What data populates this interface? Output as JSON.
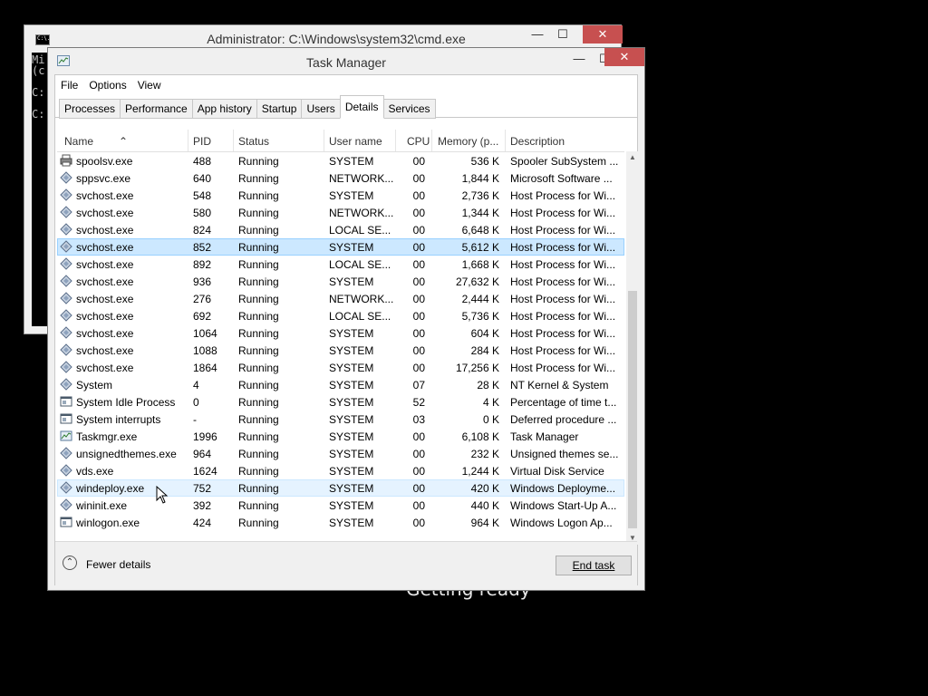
{
  "cmd_window": {
    "title": "Administrator: C:\\Windows\\system32\\cmd.exe",
    "icon_text": "C:\\.",
    "console_lines": [
      "Mi",
      "(c",
      "",
      "C:",
      "",
      "C:"
    ]
  },
  "background_text": "Getting ready",
  "task_manager": {
    "title": "Task Manager",
    "menu": [
      "File",
      "Options",
      "View"
    ],
    "tabs": [
      "Processes",
      "Performance",
      "App history",
      "Startup",
      "Users",
      "Details",
      "Services"
    ],
    "active_tab": "Details",
    "columns": [
      "Name",
      "PID",
      "Status",
      "User name",
      "CPU",
      "Memory (p...",
      "Description"
    ],
    "rows": [
      {
        "name": "spoolsv.exe",
        "pid": "488",
        "status": "Running",
        "user": "SYSTEM",
        "cpu": "00",
        "mem": "536 K",
        "desc": "Spooler SubSystem ...",
        "icon": "printer-icon"
      },
      {
        "name": "sppsvc.exe",
        "pid": "640",
        "status": "Running",
        "user": "NETWORK...",
        "cpu": "00",
        "mem": "1,844 K",
        "desc": "Microsoft Software ...",
        "icon": "process-icon"
      },
      {
        "name": "svchost.exe",
        "pid": "548",
        "status": "Running",
        "user": "SYSTEM",
        "cpu": "00",
        "mem": "2,736 K",
        "desc": "Host Process for Wi...",
        "icon": "process-icon"
      },
      {
        "name": "svchost.exe",
        "pid": "580",
        "status": "Running",
        "user": "NETWORK...",
        "cpu": "00",
        "mem": "1,344 K",
        "desc": "Host Process for Wi...",
        "icon": "process-icon"
      },
      {
        "name": "svchost.exe",
        "pid": "824",
        "status": "Running",
        "user": "LOCAL SE...",
        "cpu": "00",
        "mem": "6,648 K",
        "desc": "Host Process for Wi...",
        "icon": "process-icon"
      },
      {
        "name": "svchost.exe",
        "pid": "852",
        "status": "Running",
        "user": "SYSTEM",
        "cpu": "00",
        "mem": "5,612 K",
        "desc": "Host Process for Wi...",
        "icon": "process-icon"
      },
      {
        "name": "svchost.exe",
        "pid": "892",
        "status": "Running",
        "user": "LOCAL SE...",
        "cpu": "00",
        "mem": "1,668 K",
        "desc": "Host Process for Wi...",
        "icon": "process-icon"
      },
      {
        "name": "svchost.exe",
        "pid": "936",
        "status": "Running",
        "user": "SYSTEM",
        "cpu": "00",
        "mem": "27,632 K",
        "desc": "Host Process for Wi...",
        "icon": "process-icon"
      },
      {
        "name": "svchost.exe",
        "pid": "276",
        "status": "Running",
        "user": "NETWORK...",
        "cpu": "00",
        "mem": "2,444 K",
        "desc": "Host Process for Wi...",
        "icon": "process-icon"
      },
      {
        "name": "svchost.exe",
        "pid": "692",
        "status": "Running",
        "user": "LOCAL SE...",
        "cpu": "00",
        "mem": "5,736 K",
        "desc": "Host Process for Wi...",
        "icon": "process-icon"
      },
      {
        "name": "svchost.exe",
        "pid": "1064",
        "status": "Running",
        "user": "SYSTEM",
        "cpu": "00",
        "mem": "604 K",
        "desc": "Host Process for Wi...",
        "icon": "process-icon"
      },
      {
        "name": "svchost.exe",
        "pid": "1088",
        "status": "Running",
        "user": "SYSTEM",
        "cpu": "00",
        "mem": "284 K",
        "desc": "Host Process for Wi...",
        "icon": "process-icon"
      },
      {
        "name": "svchost.exe",
        "pid": "1864",
        "status": "Running",
        "user": "SYSTEM",
        "cpu": "00",
        "mem": "17,256 K",
        "desc": "Host Process for Wi...",
        "icon": "process-icon"
      },
      {
        "name": "System",
        "pid": "4",
        "status": "Running",
        "user": "SYSTEM",
        "cpu": "07",
        "mem": "28 K",
        "desc": "NT Kernel & System",
        "icon": "process-icon"
      },
      {
        "name": "System Idle Process",
        "pid": "0",
        "status": "Running",
        "user": "SYSTEM",
        "cpu": "52",
        "mem": "4 K",
        "desc": "Percentage of time t...",
        "icon": "window-icon"
      },
      {
        "name": "System interrupts",
        "pid": "-",
        "status": "Running",
        "user": "SYSTEM",
        "cpu": "03",
        "mem": "0 K",
        "desc": "Deferred procedure ...",
        "icon": "window-icon"
      },
      {
        "name": "Taskmgr.exe",
        "pid": "1996",
        "status": "Running",
        "user": "SYSTEM",
        "cpu": "00",
        "mem": "6,108 K",
        "desc": "Task Manager",
        "icon": "taskmgr-icon"
      },
      {
        "name": "unsignedthemes.exe",
        "pid": "964",
        "status": "Running",
        "user": "SYSTEM",
        "cpu": "00",
        "mem": "232 K",
        "desc": "Unsigned themes se...",
        "icon": "process-icon"
      },
      {
        "name": "vds.exe",
        "pid": "1624",
        "status": "Running",
        "user": "SYSTEM",
        "cpu": "00",
        "mem": "1,244 K",
        "desc": "Virtual Disk Service",
        "icon": "process-icon"
      },
      {
        "name": "windeploy.exe",
        "pid": "752",
        "status": "Running",
        "user": "SYSTEM",
        "cpu": "00",
        "mem": "420 K",
        "desc": "Windows Deployme...",
        "icon": "process-icon"
      },
      {
        "name": "wininit.exe",
        "pid": "392",
        "status": "Running",
        "user": "SYSTEM",
        "cpu": "00",
        "mem": "440 K",
        "desc": "Windows Start-Up A...",
        "icon": "process-icon"
      },
      {
        "name": "winlogon.exe",
        "pid": "424",
        "status": "Running",
        "user": "SYSTEM",
        "cpu": "00",
        "mem": "964 K",
        "desc": "Windows Logon Ap...",
        "icon": "window-icon"
      }
    ],
    "selected_pid": "852",
    "hover_pid": "752",
    "footer": {
      "fewer_details": "Fewer details",
      "end_task": "End task"
    }
  },
  "colors": {
    "selected_row": "#cce8ff",
    "hover_row": "#e5f3ff",
    "close_button": "#c75050"
  }
}
